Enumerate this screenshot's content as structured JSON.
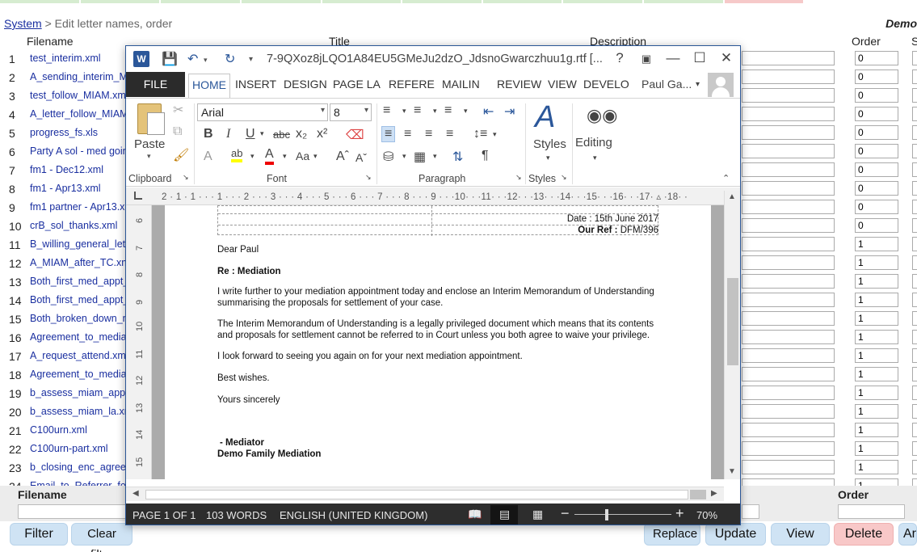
{
  "breadcrumb": {
    "link": "System",
    "rest": " > Edit letter names, order",
    "right": "Demo"
  },
  "columns": {
    "num": "",
    "filename": "Filename",
    "title": "Title",
    "description": "Description",
    "order": "Order",
    "s": "S"
  },
  "rows": [
    {
      "n": "1",
      "file": "test_interim.xml",
      "order": "0"
    },
    {
      "n": "2",
      "file": "A_sending_interim_MoU",
      "order": "0"
    },
    {
      "n": "3",
      "file": "test_follow_MIAM.xml",
      "order": "0"
    },
    {
      "n": "4",
      "file": "A_letter_follow_MIAM",
      "order": "0"
    },
    {
      "n": "5",
      "file": "progress_fs.xls",
      "order": "0"
    },
    {
      "n": "6",
      "file": "Party A sol - med going",
      "order": "0"
    },
    {
      "n": "7",
      "file": "fm1 - Dec12.xml",
      "order": "0"
    },
    {
      "n": "8",
      "file": "fm1 - Apr13.xml",
      "order": "0"
    },
    {
      "n": "9",
      "file": "fm1 partner - Apr13.xml",
      "order": "0"
    },
    {
      "n": "10",
      "file": "crB_sol_thanks.xml",
      "order": "0"
    },
    {
      "n": "11",
      "file": "B_willing_general_letter",
      "order": "1"
    },
    {
      "n": "12",
      "file": "A_MIAM_after_TC.xml",
      "order": "1"
    },
    {
      "n": "13",
      "file": "Both_first_med_appt_",
      "order": "1"
    },
    {
      "n": "14",
      "file": "Both_first_med_appt_",
      "order": "1"
    },
    {
      "n": "15",
      "file": "Both_broken_down_n",
      "order": "1"
    },
    {
      "n": "16",
      "file": "Agreement_to_mediate",
      "order": "1"
    },
    {
      "n": "17",
      "file": "A_request_attend.xml",
      "order": "1"
    },
    {
      "n": "18",
      "file": "Agreement_to_mediate",
      "order": "1"
    },
    {
      "n": "19",
      "file": "b_assess_miam_app.",
      "order": "1"
    },
    {
      "n": "20",
      "file": "b_assess_miam_la.xml",
      "order": "1"
    },
    {
      "n": "21",
      "file": "C100urn.xml",
      "order": "1"
    },
    {
      "n": "22",
      "file": "C100urn-part.xml",
      "order": "1"
    },
    {
      "n": "23",
      "file": "b_closing_enc_agreed",
      "order": "1"
    },
    {
      "n": "24",
      "file": "Email_to_Referrer_fol",
      "order": "1"
    }
  ],
  "filter": {
    "filename_label": "Filename",
    "order_label": "Order"
  },
  "buttons": {
    "filter": "Filter",
    "clear": "Clear filter",
    "replace": "Replace",
    "update": "Update",
    "view": "View",
    "delete": "Delete",
    "more": "Ar"
  },
  "word": {
    "logo": "W",
    "title": "7-9QXoz8jLQO1A84EU5GMeJu2dzO_JdsnoGwarczhuu1g.rtf [...",
    "tabs": [
      "HOME",
      "INSERT",
      "DESIGN",
      "PAGE LA",
      "REFERE",
      "MAILIN",
      "REVIEW",
      "VIEW",
      "DEVELO"
    ],
    "file_tab": "FILE",
    "user": "Paul Ga...",
    "font_name": "Arial",
    "font_size": "8",
    "paste_label": "Paste",
    "styles_label": "Styles",
    "editing_label": "Editing",
    "groups": {
      "clipboard": "Clipboard",
      "font": "Font",
      "paragraph": "Paragraph",
      "styles": "Styles"
    },
    "ruler_text": "2 · 1 · 1 · · · 1 · · · 2 · · · 3 · · · 4 · · · 5 · · · 6 · · · 7 · · · 8 · · · 9 · · ·10· · ·11· · ·12· · ·13· · ·14· · ·15· · ·16· · ·17· ▵ ·18· ·",
    "vruler": [
      "6",
      "7",
      "8",
      "9",
      "10",
      "11",
      "12",
      "13",
      "14",
      "15"
    ],
    "letter": {
      "date": "Date : 15th June 2017",
      "ref_label": "Our Ref :",
      "ref_value": " DFM/396",
      "greeting": "Dear Paul",
      "re": "Re : Mediation",
      "p1a": "I write further to your mediation appointment today and enclose an Interim Memorandum of Understanding",
      "p1b": "summarising the proposals for settlement of your case.",
      "p2a": "The Interim Memorandum of Understanding is a legally privileged document which means that its contents",
      "p2b": "and proposals for settlement cannot be referred to in Court unless you both agree to waive your privilege.",
      "p3": "I look forward to seeing you again on   for your next mediation appointment.",
      "wishes": "Best wishes.",
      "sign": "Yours sincerely",
      "role": " - Mediator",
      "org": "Demo Family Mediation"
    },
    "status": {
      "page": "PAGE 1 OF 1",
      "words": "103 WORDS",
      "lang": "ENGLISH (UNITED KINGDOM)",
      "zoom": "70%"
    }
  }
}
